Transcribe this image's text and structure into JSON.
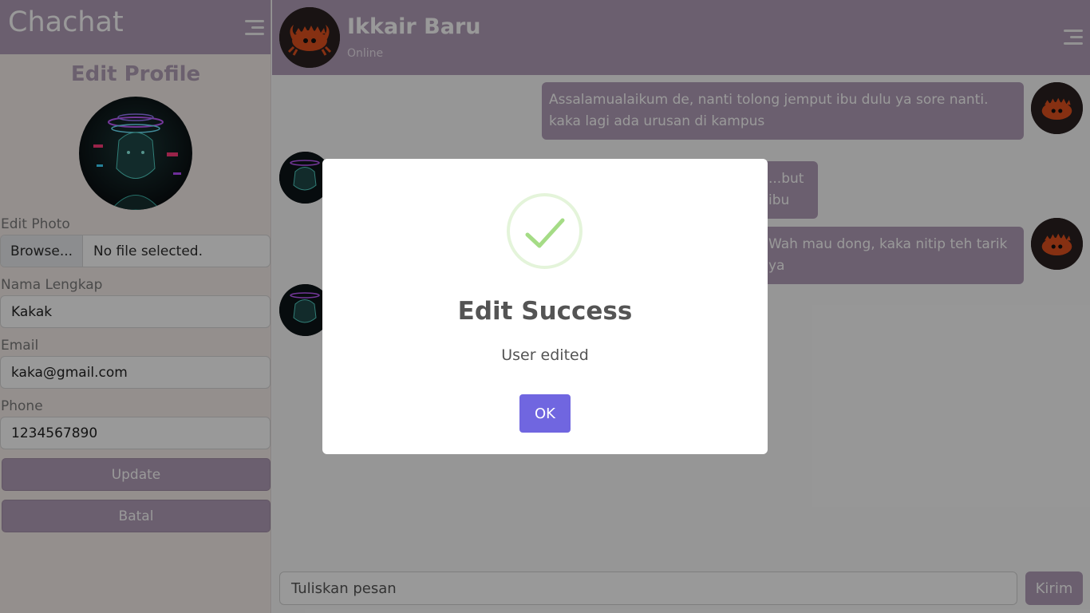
{
  "sidebar": {
    "app_title": "Chachat",
    "menu_icon": "hamburger-menu-icon",
    "edit_profile": {
      "heading": "Edit Profile",
      "photo_label": "Edit Photo",
      "browse_label": "Browse...",
      "file_status": "No file selected.",
      "name_label": "Nama Lengkap",
      "name_value": "Kakak",
      "email_label": "Email",
      "email_value": "kaka@gmail.com",
      "phone_label": "Phone",
      "phone_value": "1234567890",
      "update_label": "Update",
      "cancel_label": "Batal"
    }
  },
  "chat": {
    "contact": {
      "name": "Ikkair Baru",
      "status": "Online"
    },
    "menu_icon": "hamburger-menu-icon",
    "messages": [
      {
        "side": "right",
        "text": "Assalamualaikum de, nanti tolong jemput ibu dulu ya sore nanti. kaka lagi ada urusan di kampus"
      },
      {
        "side": "left",
        "text": "...but ibu"
      },
      {
        "side": "right",
        "text": "Wah mau dong, kaka nitip teh tarik ya"
      },
      {
        "side": "left",
        "text": ""
      }
    ],
    "composer": {
      "placeholder": "Tuliskan pesan",
      "send_label": "Kirim"
    }
  },
  "modal": {
    "icon": "success-check-icon",
    "title": "Edit Success",
    "text": "User edited",
    "ok_label": "OK"
  },
  "colors": {
    "brand": "#b39fb9",
    "confirm": "#7066e0",
    "success": "#a5dc86"
  }
}
